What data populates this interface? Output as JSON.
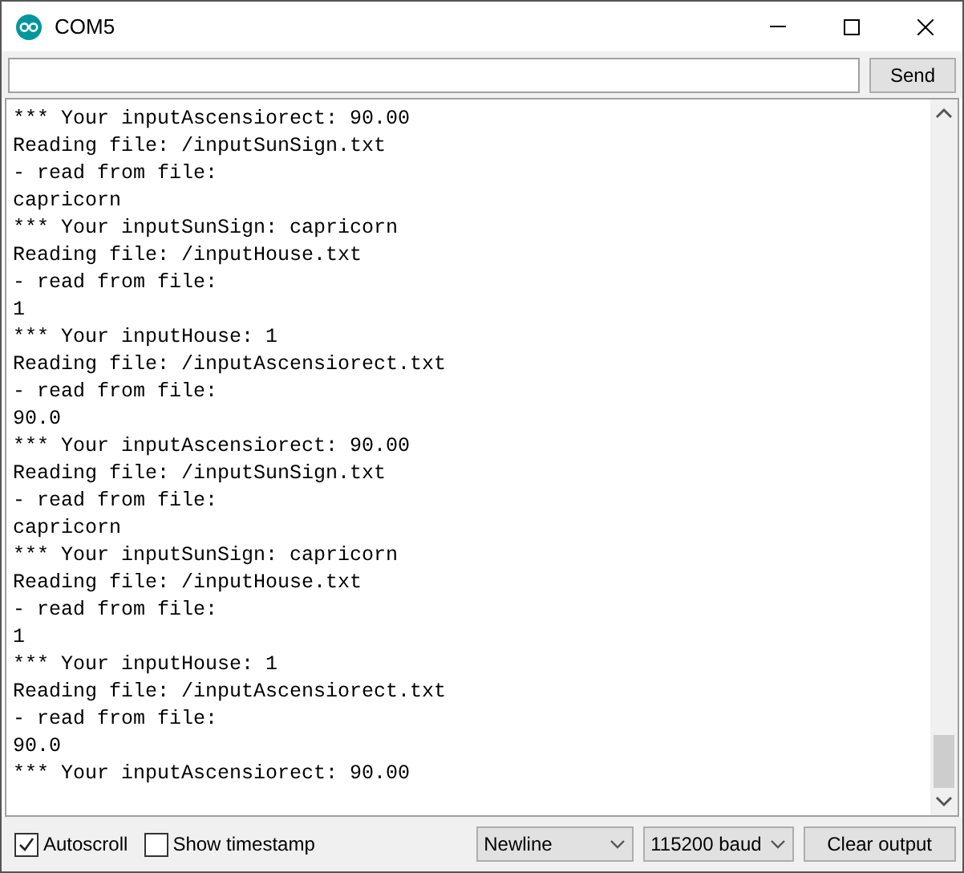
{
  "window": {
    "title": "COM5"
  },
  "send_button": "Send",
  "output_lines": [
    "*** Your inputAscensiorect: 90.00",
    "Reading file: /inputSunSign.txt",
    "- read from file:",
    "capricorn",
    "*** Your inputSunSign: capricorn",
    "Reading file: /inputHouse.txt",
    "- read from file:",
    "1",
    "*** Your inputHouse: 1",
    "Reading file: /inputAscensiorect.txt",
    "- read from file:",
    "90.0",
    "*** Your inputAscensiorect: 90.00",
    "Reading file: /inputSunSign.txt",
    "- read from file:",
    "capricorn",
    "*** Your inputSunSign: capricorn",
    "Reading file: /inputHouse.txt",
    "- read from file:",
    "1",
    "*** Your inputHouse: 1",
    "Reading file: /inputAscensiorect.txt",
    "- read from file:",
    "90.0",
    "*** Your inputAscensiorect: 90.00"
  ],
  "options": [
    {
      "label": "Autoscroll",
      "checked": true
    },
    {
      "label": "Show timestamp",
      "checked": false
    }
  ],
  "line_ending": "Newline",
  "baud_rate": "115200 baud",
  "clear_button": "Clear output"
}
